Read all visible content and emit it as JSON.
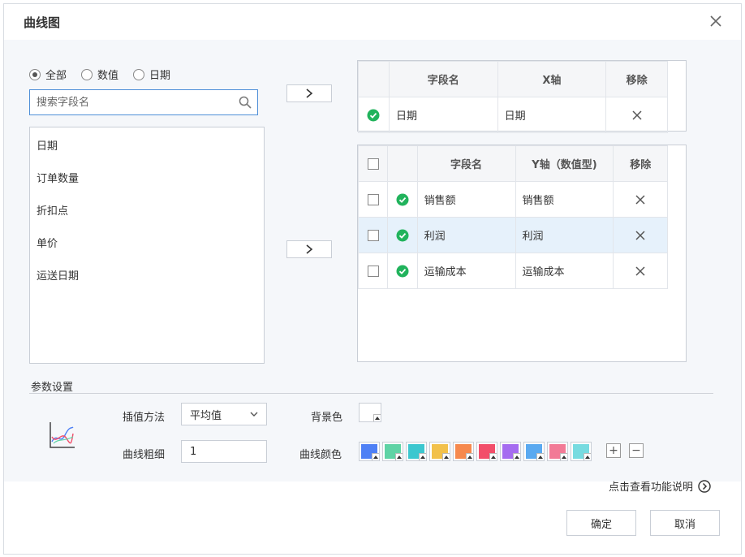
{
  "dialog": {
    "title": "曲线图"
  },
  "filter": {
    "options": [
      {
        "label": "全部",
        "selected": true
      },
      {
        "label": "数值",
        "selected": false
      },
      {
        "label": "日期",
        "selected": false
      }
    ]
  },
  "search": {
    "placeholder": "搜索字段名"
  },
  "fields": [
    "日期",
    "订单数量",
    "折扣点",
    "单价",
    "运送日期"
  ],
  "x_table": {
    "headers": [
      "字段名",
      "X轴",
      "移除"
    ],
    "rows": [
      {
        "field": "日期",
        "axis": "日期"
      }
    ]
  },
  "y_table": {
    "headers": [
      "字段名",
      "Y轴（数值型)",
      "移除"
    ],
    "rows": [
      {
        "field": "销售额",
        "axis": "销售额",
        "checked": false,
        "selected": false
      },
      {
        "field": "利润",
        "axis": "利润",
        "checked": false,
        "selected": true
      },
      {
        "field": "运输成本",
        "axis": "运输成本",
        "checked": false,
        "selected": false
      }
    ]
  },
  "params": {
    "section_label": "参数设置",
    "interp_label": "插值方法",
    "interp_value": "平均值",
    "width_label": "曲线粗细",
    "width_value": "1",
    "bg_label": "背景色",
    "bg_color": "#ffffff",
    "color_label": "曲线颜色",
    "colors": [
      "#4e80f5",
      "#5fd3a5",
      "#3cc7cf",
      "#f2c14b",
      "#f6894d",
      "#f24e6a",
      "#a56cf0",
      "#5aa9f0",
      "#f27a96",
      "#77dbe0"
    ]
  },
  "help": {
    "label": "点击查看功能说明"
  },
  "buttons": {
    "ok": "确定",
    "cancel": "取消"
  },
  "colors": {
    "accent": "#4f8fd8",
    "success": "#21b35c",
    "selected_row": "#e6f1fb"
  }
}
